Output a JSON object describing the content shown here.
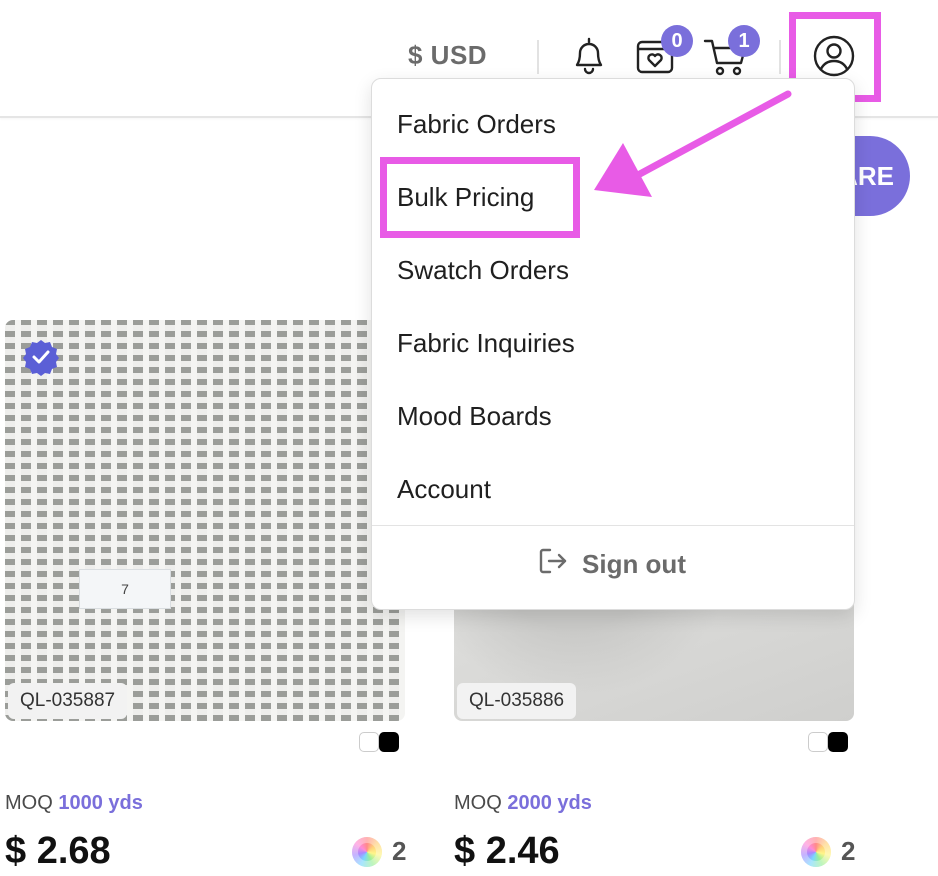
{
  "header": {
    "currency": "$ USD",
    "favorites_count": "0",
    "cart_count": "1"
  },
  "share_button": {
    "label": "ARE"
  },
  "account_menu": {
    "items": [
      {
        "label": "Fabric Orders"
      },
      {
        "label": "Bulk Pricing"
      },
      {
        "label": "Swatch Orders"
      },
      {
        "label": "Fabric Inquiries"
      },
      {
        "label": "Mood Boards"
      },
      {
        "label": "Account"
      }
    ],
    "sign_out": "Sign out"
  },
  "products": [
    {
      "sku": "QL-035887",
      "label_note": "7",
      "moq_label": "MOQ",
      "moq_value": "1000 yds",
      "price": "$ 2.68",
      "color_count": "2"
    },
    {
      "sku": "QL-035886",
      "moq_label": "MOQ",
      "moq_value": "2000 yds",
      "price": "$ 2.46",
      "color_count": "2"
    }
  ],
  "annotation": {
    "color": "#e85be6",
    "accent": "#7a6fdb"
  }
}
